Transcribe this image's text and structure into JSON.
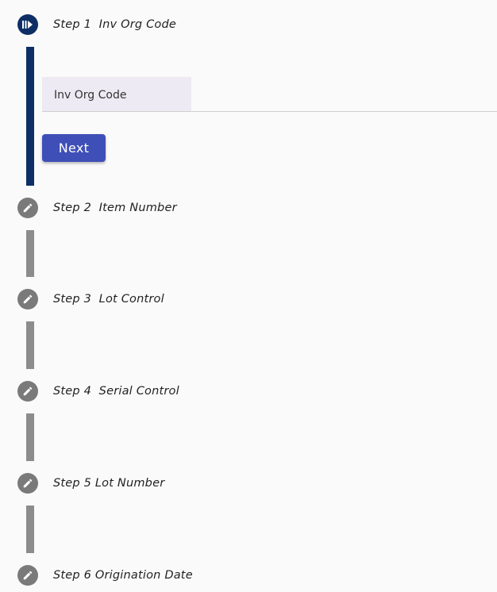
{
  "steps": [
    {
      "label": "Step 1  Inv Org Code",
      "state": "active",
      "icon": "step-active-icon"
    },
    {
      "label": "Step 2  Item Number",
      "state": "editable",
      "icon": "pencil-icon"
    },
    {
      "label": "Step 3  Lot Control",
      "state": "editable",
      "icon": "pencil-icon"
    },
    {
      "label": "Step 4  Serial Control",
      "state": "editable",
      "icon": "pencil-icon"
    },
    {
      "label": "Step 5 Lot Number",
      "state": "editable",
      "icon": "pencil-icon"
    },
    {
      "label": "Step 6 Origination Date",
      "state": "editable",
      "icon": "pencil-icon"
    }
  ],
  "step1_form": {
    "field_placeholder": "Inv Org Code",
    "field_value": "",
    "next_label": "Next"
  },
  "colors": {
    "active": "#0d2f66",
    "inactive": "#8c8c8c",
    "button": "#3f4fb8",
    "field_bg": "#edeaf3",
    "background": "#fafafa"
  }
}
